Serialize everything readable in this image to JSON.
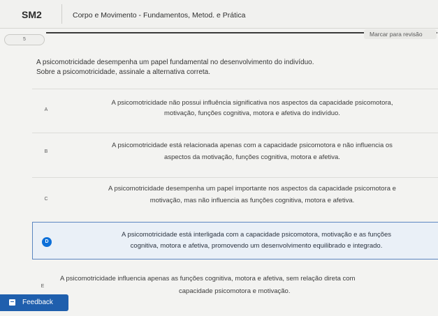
{
  "header": {
    "course_code": "SM2",
    "course_title": "Corpo e Movimento - Fundamentos, Metod. e Prática"
  },
  "question": {
    "number": "5",
    "review_label": "Marcar para revisão",
    "stem_line1": "A psicomotricidade desempenha um papel fundamental no desenvolvimento do indivíduo.",
    "stem_line2": "Sobre a psicomotricidade, assinale a alternativa correta.",
    "selected": "D",
    "options": [
      {
        "letter": "A",
        "line1": "A psicomotricidade não possui influência significativa nos aspectos da capacidade psicomotora,",
        "line2": "motivação, funções cognitiva, motora e afetiva do indivíduo."
      },
      {
        "letter": "B",
        "line1": "A psicomotricidade está relacionada apenas com a capacidade psicomotora e não influencia os",
        "line2": "aspectos da motivação, funções cognitiva, motora e afetiva."
      },
      {
        "letter": "C",
        "line1": "A psicomotricidade desempenha um papel importante nos aspectos da capacidade psicomotora e",
        "line2": "motivação, mas não influencia as funções cognitiva, motora e afetiva."
      },
      {
        "letter": "D",
        "line1": "A psicomotricidade está interligada com a capacidade psicomotora, motivação e as funções",
        "line2": "cognitiva, motora e afetiva, promovendo um desenvolvimento equilibrado e integrado."
      },
      {
        "letter": "E",
        "line1": "A psicomotricidade influencia apenas as funções cognitiva, motora e afetiva, sem relação direta com",
        "line2": "capacidade psicomotora e motivação."
      }
    ]
  },
  "feedback": {
    "label": "Feedback",
    "icon": "feedback-icon"
  },
  "colors": {
    "accent": "#0d6fd8",
    "feedback_bg": "#1f5fad",
    "selected_bg": "#eaf0f7",
    "selected_border": "#5b86c0"
  }
}
